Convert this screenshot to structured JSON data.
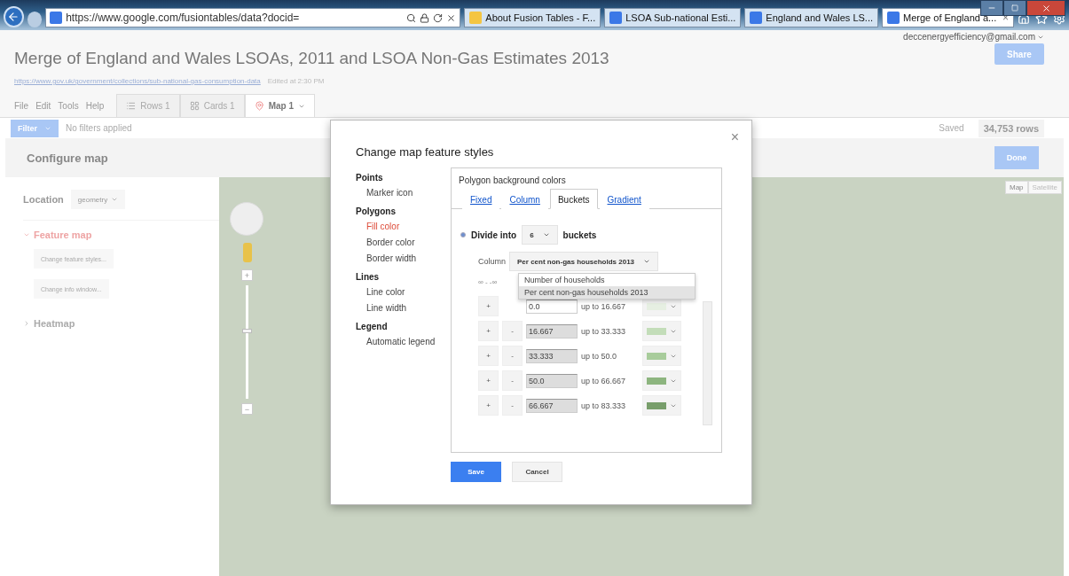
{
  "browser": {
    "url": "https://www.google.com/fusiontables/data?docid=",
    "tabs": [
      {
        "label": "About Fusion Tables - F...",
        "selected": false,
        "color": "#f4c542"
      },
      {
        "label": "LSOA Sub-national Esti...",
        "selected": false,
        "color": "#3b78e7"
      },
      {
        "label": "England and Wales LS...",
        "selected": false,
        "color": "#3b78e7"
      },
      {
        "label": "Merge of England a...",
        "selected": true,
        "color": "#3b78e7"
      }
    ],
    "close": "×"
  },
  "account": "deccenergyefficiency@gmail.com",
  "share": "Share",
  "title": "Merge of England and Wales LSOAs, 2011 and LSOA Non-Gas Estimates 2013",
  "source_link": "https://www.gov.uk/government/collections/sub-national-gas-consumption-data",
  "edited": "Edited at 2:30 PM",
  "menu": [
    "File",
    "Edit",
    "Tools",
    "Help"
  ],
  "view_tabs": [
    {
      "label": "Rows 1",
      "kind": "rows",
      "selected": false
    },
    {
      "label": "Cards 1",
      "kind": "cards",
      "selected": false
    },
    {
      "label": "Map 1",
      "kind": "map",
      "selected": true
    }
  ],
  "filter": {
    "button": "Filter",
    "status": "No filters applied"
  },
  "saved": "Saved",
  "row_count": "34,753 rows",
  "configure": {
    "title": "Configure map",
    "done": "Done",
    "location_label": "Location",
    "location_value": "geometry",
    "sections": [
      {
        "label": "Feature map",
        "expanded": true,
        "buttons": [
          "Change feature styles...",
          "Change info window..."
        ]
      },
      {
        "label": "Heatmap",
        "expanded": false
      }
    ]
  },
  "map": {
    "zoom": {
      "level": 0.6,
      "in": "+",
      "out": "−"
    },
    "types": [
      {
        "label": "Map",
        "selected": true
      },
      {
        "label": "Satellite",
        "selected": false
      }
    ]
  },
  "dialog": {
    "title": "Change map feature styles",
    "close": "×",
    "nav": [
      {
        "heading": "Points",
        "items": [
          {
            "label": "Marker icon",
            "selected": false
          }
        ]
      },
      {
        "heading": "Polygons",
        "items": [
          {
            "label": "Fill color",
            "selected": true
          },
          {
            "label": "Border color",
            "selected": false
          },
          {
            "label": "Border width",
            "selected": false
          }
        ]
      },
      {
        "heading": "Lines",
        "items": [
          {
            "label": "Line color",
            "selected": false
          },
          {
            "label": "Line width",
            "selected": false
          }
        ]
      },
      {
        "heading": "Legend",
        "items": [
          {
            "label": "Automatic legend",
            "selected": false
          }
        ]
      }
    ],
    "panel_title": "Polygon background colors",
    "tabs": [
      {
        "label": "Fixed",
        "selected": false
      },
      {
        "label": "Column",
        "selected": false
      },
      {
        "label": "Buckets",
        "selected": true
      },
      {
        "label": "Gradient",
        "selected": false
      }
    ],
    "divide": {
      "selected": true,
      "label": "Divide into",
      "count": "6",
      "suffix": "buckets"
    },
    "column_label": "Column",
    "column_value": "Per cent non-gas households 2013",
    "column_options": [
      {
        "label": "Number of households",
        "selected": false
      },
      {
        "label": "Per cent non-gas households 2013",
        "selected": true
      }
    ],
    "range_hint": "∞ - -∞",
    "buckets": [
      {
        "from": "0.0",
        "to": "up to 16.667",
        "removable": false,
        "disabled": false,
        "color": "#e6efe2"
      },
      {
        "from": "16.667",
        "to": "up to 33.333",
        "removable": true,
        "disabled": true,
        "color": "#c3ddb9"
      },
      {
        "from": "33.333",
        "to": "up to 50.0",
        "removable": true,
        "disabled": true,
        "color": "#a8cc9b"
      },
      {
        "from": "50.0",
        "to": "up to 66.667",
        "removable": true,
        "disabled": true,
        "color": "#8db57f"
      },
      {
        "from": "66.667",
        "to": "up to 83.333",
        "removable": true,
        "disabled": true,
        "color": "#789e6b"
      }
    ],
    "add": "+",
    "remove": "-",
    "save": "Save",
    "cancel": "Cancel"
  }
}
